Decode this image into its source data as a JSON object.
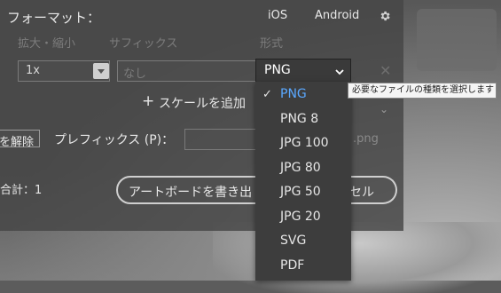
{
  "panel": {
    "format_label": "フォーマット：",
    "os_ios": "iOS",
    "os_android": "Android",
    "header_scale": "拡大・縮小",
    "header_suffix": "サフィックス",
    "header_format": "形式",
    "scale_value": "1x",
    "suffix_placeholder": "なし",
    "add_scale_label": "スケールを追加",
    "clear_label": "を解除",
    "prefix_label": "プレフィックス (P)：",
    "filename_suffix": ".png",
    "total_label": "合計：1",
    "export_button_label": "アートボードを書き出",
    "cancel_button_tail": "セル"
  },
  "format_select": {
    "value": "PNG",
    "options": [
      "PNG",
      "PNG 8",
      "JPG 100",
      "JPG 80",
      "JPG 50",
      "JPG 20",
      "SVG",
      "PDF"
    ],
    "selected_index": 0,
    "tooltip": "必要なファイルの種類を選択します"
  },
  "colors": {
    "accent": "#5aa8ff",
    "menu_bg": "#3d3d3d"
  }
}
